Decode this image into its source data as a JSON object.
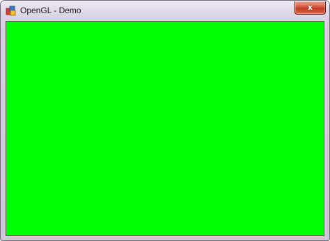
{
  "window": {
    "title": "OpenGL - Demo",
    "close_symbol": "x",
    "app_icon": "app-icon",
    "close_icon": "close-icon"
  },
  "canvas": {
    "clear_color": "#00ff00"
  }
}
